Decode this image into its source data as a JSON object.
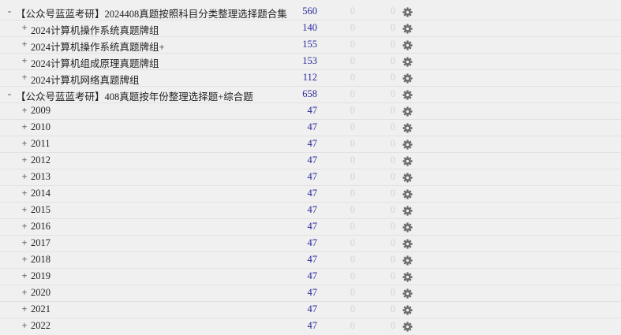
{
  "decks": [
    {
      "toggle": "-",
      "name": "【公众号蓝蓝考研】2024408真题按照科目分类整理选择题合集",
      "new": "560",
      "learn": "0",
      "due": "0",
      "depth": 0
    },
    {
      "toggle": "+",
      "name": "2024计算机操作系统真题牌组",
      "new": "140",
      "learn": "0",
      "due": "0",
      "depth": 1
    },
    {
      "toggle": "+",
      "name": "2024计算机操作系统真题牌组+",
      "new": "155",
      "learn": "0",
      "due": "0",
      "depth": 1
    },
    {
      "toggle": "+",
      "name": "2024计算机组成原理真题牌组",
      "new": "153",
      "learn": "0",
      "due": "0",
      "depth": 1
    },
    {
      "toggle": "+",
      "name": "2024计算机网络真题牌组",
      "new": "112",
      "learn": "0",
      "due": "0",
      "depth": 1
    },
    {
      "toggle": "-",
      "name": "【公众号蓝蓝考研】408真题按年份整理选择题+综合题",
      "new": "658",
      "learn": "0",
      "due": "0",
      "depth": 0
    },
    {
      "toggle": "+",
      "name": "2009",
      "new": "47",
      "learn": "0",
      "due": "0",
      "depth": 1
    },
    {
      "toggle": "+",
      "name": "2010",
      "new": "47",
      "learn": "0",
      "due": "0",
      "depth": 1
    },
    {
      "toggle": "+",
      "name": "2011",
      "new": "47",
      "learn": "0",
      "due": "0",
      "depth": 1
    },
    {
      "toggle": "+",
      "name": "2012",
      "new": "47",
      "learn": "0",
      "due": "0",
      "depth": 1
    },
    {
      "toggle": "+",
      "name": "2013",
      "new": "47",
      "learn": "0",
      "due": "0",
      "depth": 1
    },
    {
      "toggle": "+",
      "name": "2014",
      "new": "47",
      "learn": "0",
      "due": "0",
      "depth": 1
    },
    {
      "toggle": "+",
      "name": "2015",
      "new": "47",
      "learn": "0",
      "due": "0",
      "depth": 1
    },
    {
      "toggle": "+",
      "name": "2016",
      "new": "47",
      "learn": "0",
      "due": "0",
      "depth": 1
    },
    {
      "toggle": "+",
      "name": "2017",
      "new": "47",
      "learn": "0",
      "due": "0",
      "depth": 1
    },
    {
      "toggle": "+",
      "name": "2018",
      "new": "47",
      "learn": "0",
      "due": "0",
      "depth": 1
    },
    {
      "toggle": "+",
      "name": "2019",
      "new": "47",
      "learn": "0",
      "due": "0",
      "depth": 1
    },
    {
      "toggle": "+",
      "name": "2020",
      "new": "47",
      "learn": "0",
      "due": "0",
      "depth": 1
    },
    {
      "toggle": "+",
      "name": "2021",
      "new": "47",
      "learn": "0",
      "due": "0",
      "depth": 1
    },
    {
      "toggle": "+",
      "name": "2022",
      "new": "47",
      "learn": "0",
      "due": "0",
      "depth": 1
    }
  ],
  "icons": {
    "options": "gear-icon"
  },
  "colors": {
    "new_count": "#2a2a9c",
    "zero_count": "#d2d2d2",
    "gear": "#6b6b6b",
    "background": "#f0f0f0"
  }
}
